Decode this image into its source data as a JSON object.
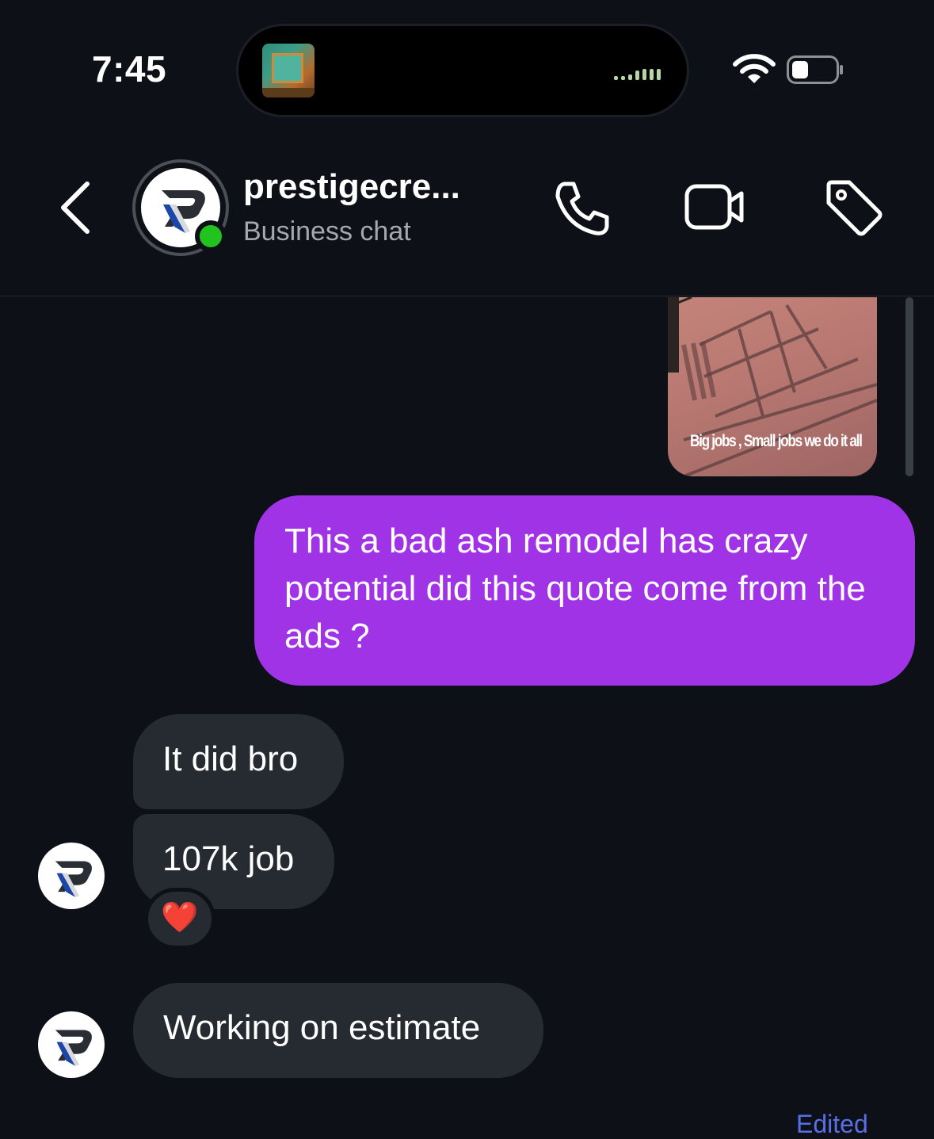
{
  "status_bar": {
    "time": "7:45",
    "wifi_icon": "wifi-icon",
    "battery_icon": "battery-icon"
  },
  "header": {
    "back_icon": "chevron-left-icon",
    "contact_name": "prestigecre...",
    "subtitle": "Business chat",
    "online": true,
    "actions": [
      "phone-icon",
      "video-camera-icon",
      "tag-icon"
    ]
  },
  "chat": {
    "media_caption": "Big jobs , Small jobs we do it all",
    "messages": [
      {
        "direction": "outgoing",
        "text": "This a bad ash remodel has crazy potential did this quote come from the ads ?"
      },
      {
        "direction": "incoming",
        "text": "It did bro"
      },
      {
        "direction": "incoming",
        "text": "107k job",
        "reaction": "❤️"
      },
      {
        "direction": "incoming",
        "text": "Working on estimate"
      }
    ],
    "edited_label": "Edited"
  },
  "colors": {
    "background": "#0d1016",
    "outgoing_bubble": "#a033e6",
    "incoming_bubble": "#262a31",
    "online": "#21c41f",
    "edited_link": "#5a6fe6"
  }
}
